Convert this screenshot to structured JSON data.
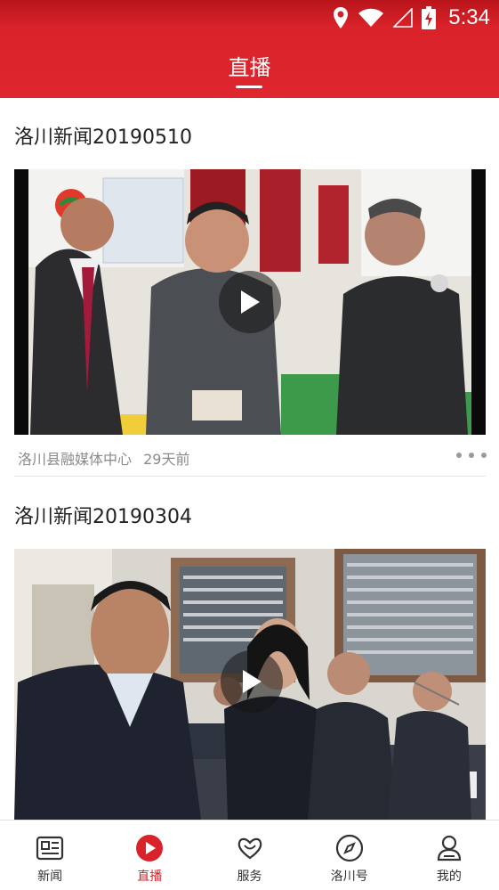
{
  "status_bar": {
    "time": "5:34"
  },
  "header": {
    "title": "直播"
  },
  "feed": [
    {
      "title": "洛川新闻20190510",
      "source": "洛川县融媒体中心",
      "age": "29天前"
    },
    {
      "title": "洛川新闻20190304"
    }
  ],
  "tabbar": {
    "items": [
      {
        "label": "新闻",
        "icon": "news-icon"
      },
      {
        "label": "直播",
        "icon": "live-play-icon",
        "active": true
      },
      {
        "label": "服务",
        "icon": "service-heart-icon"
      },
      {
        "label": "洛川号",
        "icon": "compass-icon"
      },
      {
        "label": "我的",
        "icon": "profile-icon"
      }
    ]
  },
  "colors": {
    "brand": "#d9222a",
    "text": "#222222",
    "meta": "#8a8a8a"
  }
}
